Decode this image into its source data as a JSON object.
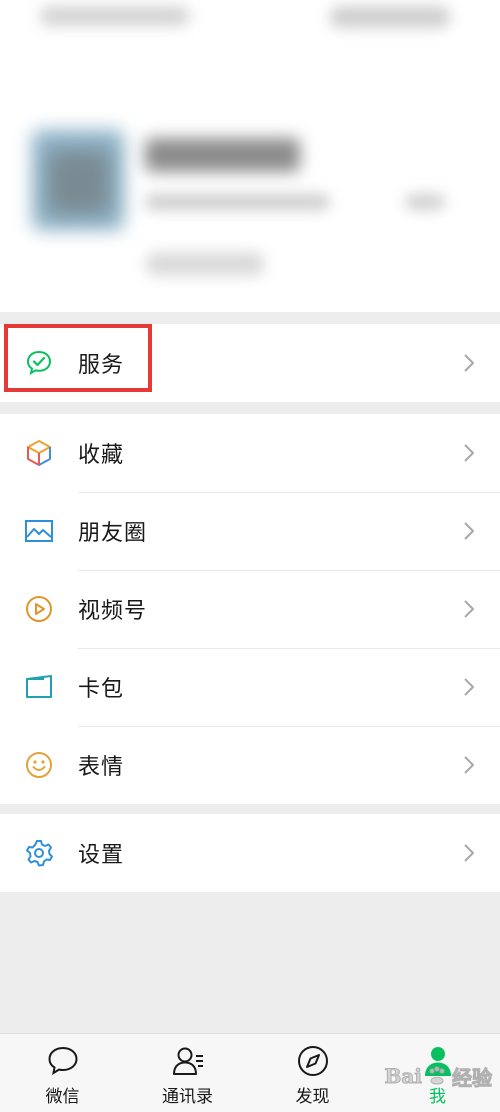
{
  "menu": {
    "service": {
      "label": "服务",
      "icon": "service-icon"
    },
    "favorites": {
      "label": "收藏",
      "icon": "cube-icon"
    },
    "moments": {
      "label": "朋友圈",
      "icon": "image-icon"
    },
    "channels": {
      "label": "视频号",
      "icon": "play-icon"
    },
    "cards": {
      "label": "卡包",
      "icon": "card-icon"
    },
    "stickers": {
      "label": "表情",
      "icon": "smiley-icon"
    },
    "settings": {
      "label": "设置",
      "icon": "gear-icon"
    }
  },
  "tabs": [
    {
      "label": "微信",
      "icon": "chat-icon"
    },
    {
      "label": "通讯录",
      "icon": "contacts-icon"
    },
    {
      "label": "发现",
      "icon": "compass-icon"
    },
    {
      "label": "我",
      "icon": "person-icon",
      "active": true
    }
  ],
  "watermark": {
    "text": "Bai",
    "suffix": "经验"
  },
  "colors": {
    "accent": "#07c160",
    "highlight": "#e53935"
  }
}
